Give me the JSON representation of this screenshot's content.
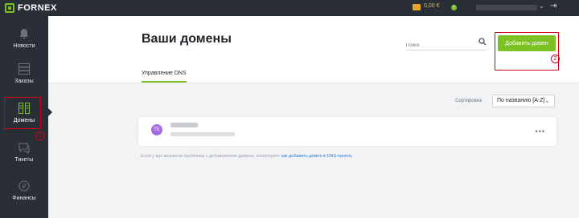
{
  "brand": {
    "name": "FORNEX",
    "accent": "#7cc225"
  },
  "topbar": {
    "balance": "0,00 €",
    "icons": [
      "wallet-icon",
      "plus-icon",
      "chevron-down-icon",
      "logout-icon"
    ]
  },
  "sidebar": {
    "items": [
      {
        "label": "Новости",
        "icon": "bell-icon"
      },
      {
        "label": "Заказы",
        "icon": "server-icon"
      },
      {
        "label": "Домены",
        "icon": "domains-icon",
        "active": true
      },
      {
        "label": "Тикеты",
        "icon": "chat-icon"
      },
      {
        "label": "Финансы",
        "icon": "wallet-icon"
      }
    ],
    "annotation": "1"
  },
  "header": {
    "title": "Ваши домены",
    "search_placeholder": "Поиск",
    "add_button": "Добавить домен",
    "annotation": "2",
    "tab": "Управление DNS"
  },
  "sort": {
    "label": "Сортировка",
    "selected": "По названию [A-Z]"
  },
  "domain_card": {
    "avatar_initials": "TE"
  },
  "hint": {
    "text": "Если у вас возникли проблемы с добавлением домена, посмотрите",
    "link": "как добавить домен в DNS-панель"
  }
}
